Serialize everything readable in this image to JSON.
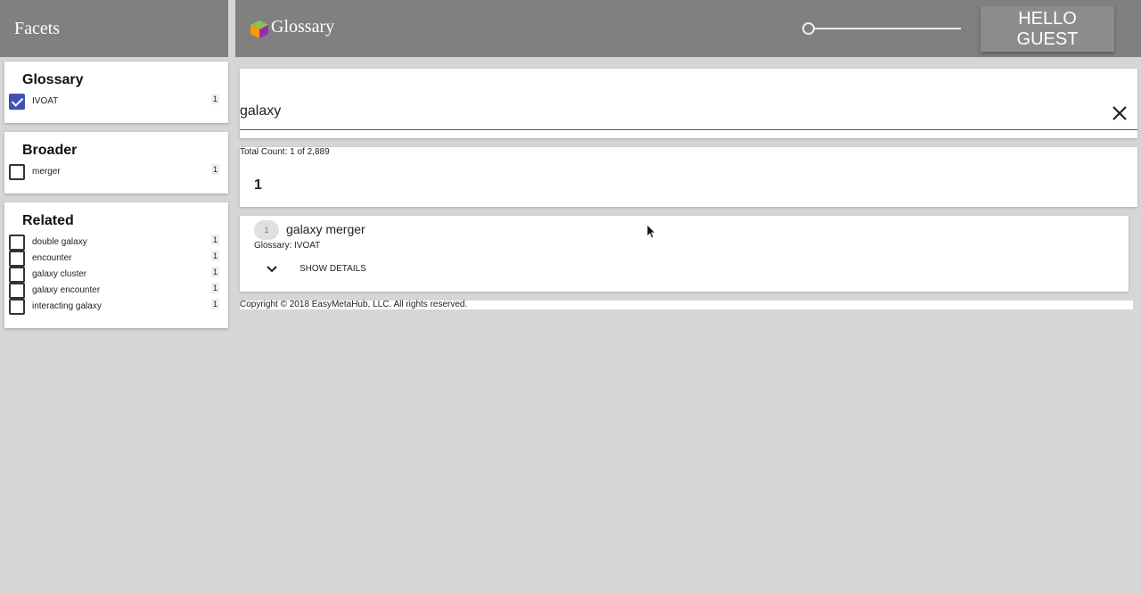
{
  "sidebar": {
    "title": "Facets",
    "facets": [
      {
        "title": "Glossary",
        "items": [
          {
            "label": "IVOAT",
            "count": "1",
            "checked": true
          }
        ]
      },
      {
        "title": "Broader",
        "items": [
          {
            "label": "merger",
            "count": "1",
            "checked": false
          }
        ]
      },
      {
        "title": "Related",
        "items": [
          {
            "label": "double galaxy",
            "count": "1",
            "checked": false
          },
          {
            "label": "encounter",
            "count": "1",
            "checked": false
          },
          {
            "label": "galaxy cluster",
            "count": "1",
            "checked": false
          },
          {
            "label": "galaxy encounter",
            "count": "1",
            "checked": false
          },
          {
            "label": "interacting galaxy",
            "count": "1",
            "checked": false
          }
        ]
      }
    ]
  },
  "header": {
    "title": "Glossary",
    "user_button": "HELLO GUEST",
    "slider_value": 0
  },
  "search": {
    "value": "galaxy"
  },
  "results": {
    "total_count": "Total Count: 1 of 2,889",
    "current_page": "1",
    "items": [
      {
        "rank": "1",
        "title": "galaxy merger",
        "subtitle": "Glossary: IVOAT",
        "details_label": "SHOW DETAILS"
      }
    ]
  },
  "footer": {
    "copyright": "Copyright © 2018 EasyMetaHub, LLC. All rights reserved."
  },
  "colors": {
    "header_bg": "#808080",
    "page_bg": "#d6d6d6",
    "checkbox_accent": "#3f51b5"
  }
}
